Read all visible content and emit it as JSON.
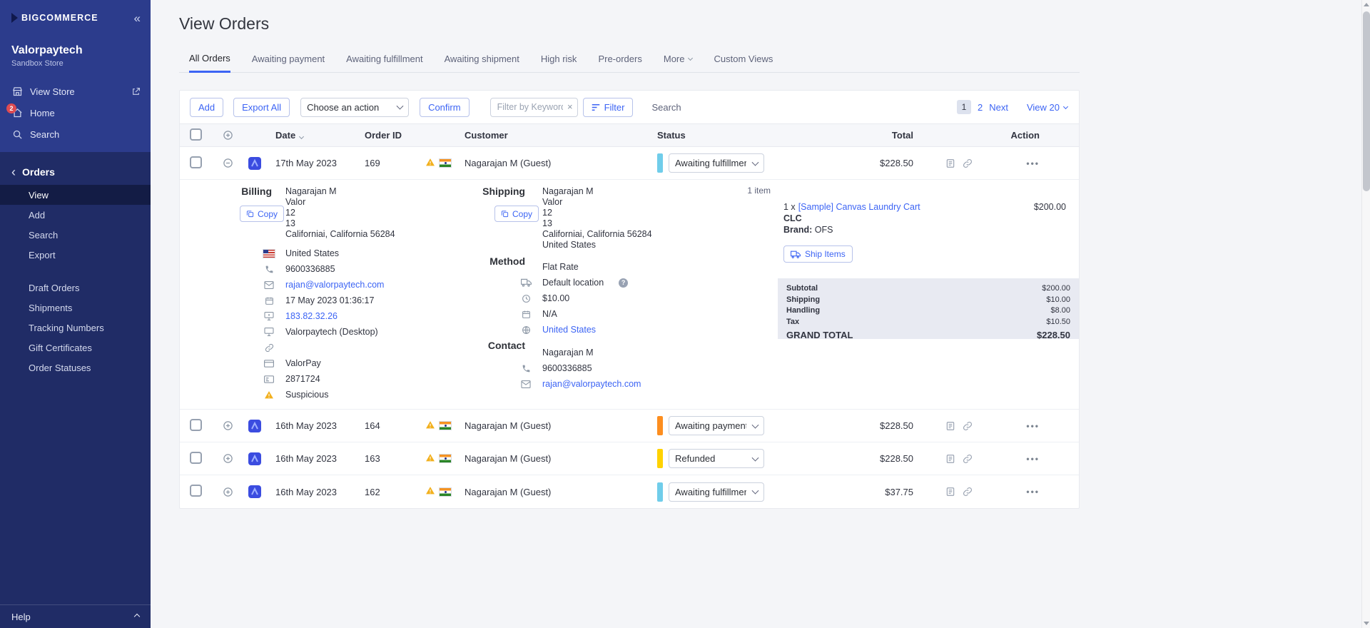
{
  "sidebar": {
    "logo": "BIGCOMMERCE",
    "store_name": "Valorpaytech",
    "store_subtitle": "Sandbox Store",
    "nav": {
      "view_store": "View Store",
      "home": "Home",
      "home_badge": "2",
      "search": "Search"
    },
    "orders": {
      "title": "Orders",
      "items": [
        "View",
        "Add",
        "Search",
        "Export"
      ]
    },
    "tools": [
      "Draft Orders",
      "Shipments",
      "Tracking Numbers",
      "Gift Certificates",
      "Order Statuses"
    ],
    "help": "Help"
  },
  "page": {
    "title": "View Orders"
  },
  "tabs": [
    "All Orders",
    "Awaiting payment",
    "Awaiting fulfillment",
    "Awaiting shipment",
    "High risk",
    "Pre-orders",
    "More",
    "Custom Views"
  ],
  "toolbar": {
    "add": "Add",
    "export_all": "Export All",
    "action_select": "Choose an action",
    "confirm": "Confirm",
    "keyword_placeholder": "Filter by Keyword",
    "clear": "×",
    "filter": "Filter",
    "search": "Search",
    "page_current": "1",
    "page_two": "2",
    "page_next": "Next",
    "view_select": "View 20"
  },
  "table": {
    "headers": {
      "date": "Date",
      "order_id": "Order ID",
      "customer": "Customer",
      "status": "Status",
      "total": "Total",
      "action": "Action"
    },
    "rows": [
      {
        "date": "17th May 2023",
        "order_id": "169",
        "customer": "Nagarajan M (Guest)",
        "status": "Awaiting fulfillment",
        "status_color": "#70cdea",
        "total": "$228.50"
      },
      {
        "date": "16th May 2023",
        "order_id": "164",
        "customer": "Nagarajan M (Guest)",
        "status": "Awaiting payment",
        "status_color": "#fd8e1f",
        "total": "$228.50"
      },
      {
        "date": "16th May 2023",
        "order_id": "163",
        "customer": "Nagarajan M (Guest)",
        "status": "Refunded",
        "status_color": "#ffd200",
        "total": "$228.50"
      },
      {
        "date": "16th May 2023",
        "order_id": "162",
        "customer": "Nagarajan M (Guest)",
        "status": "Awaiting fulfillment",
        "status_color": "#70cdea",
        "total": "$37.75"
      }
    ]
  },
  "detail": {
    "billing": {
      "label": "Billing",
      "copy": "Copy",
      "address": [
        "Nagarajan M",
        "Valor",
        "12",
        "13",
        "Californiai, California 56284"
      ],
      "country": "United States",
      "phone": "9600336885",
      "email": "rajan@valorpaytech.com",
      "date": "17 May 2023 01:36:17",
      "ip": "183.82.32.26",
      "device": "Valorpaytech (Desktop)",
      "payment_method": "ValorPay",
      "transaction_id": "2871724",
      "risk": "Suspicious"
    },
    "shipping": {
      "label": "Shipping",
      "copy": "Copy",
      "address": [
        "Nagarajan M",
        "Valor",
        "12",
        "13",
        "Californiai, California 56284",
        "United States"
      ]
    },
    "method": {
      "label": "Method",
      "name": "Flat Rate",
      "location": "Default location",
      "help": "?",
      "cost": "$10.00",
      "date": "N/A",
      "zone": "United States"
    },
    "contact": {
      "label": "Contact",
      "name": "Nagarajan M",
      "phone": "9600336885",
      "email": "rajan@valorpaytech.com"
    },
    "items": {
      "count": "1 item",
      "qty": "1 x ",
      "name": "[Sample] Canvas Laundry Cart",
      "price": "$200.00",
      "sku": "CLC",
      "brand_label": "Brand: ",
      "brand": "OFS",
      "ship_items": "Ship Items"
    },
    "totals": {
      "subtotal_label": "Subtotal",
      "subtotal": "$200.00",
      "shipping_label": "Shipping",
      "shipping": "$10.00",
      "handling_label": "Handling",
      "handling": "$8.00",
      "tax_label": "Tax",
      "tax": "$10.50",
      "grand_label": "GRAND TOTAL",
      "grand": "$228.50"
    }
  }
}
